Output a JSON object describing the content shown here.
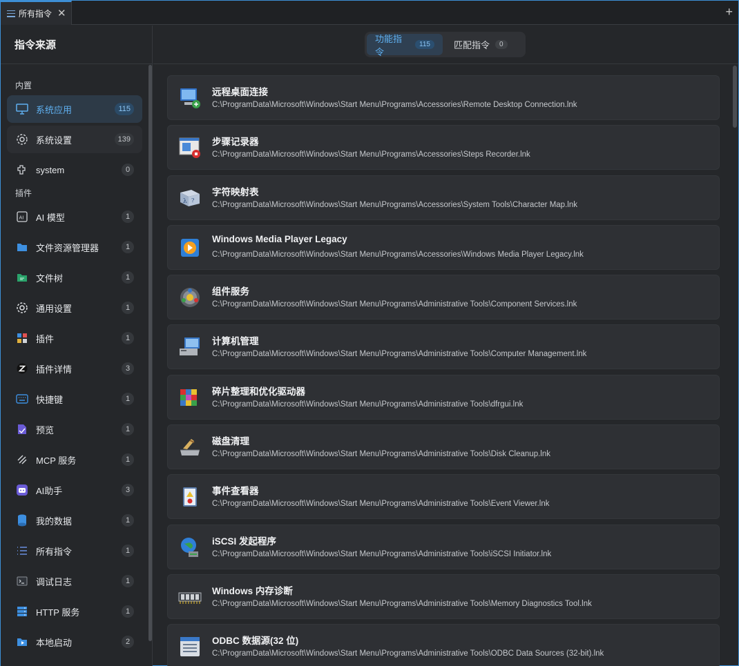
{
  "tab": {
    "title": "所有指令",
    "close_glyph": "✕",
    "add_glyph": "+"
  },
  "sidebar": {
    "title": "指令来源",
    "sections": {
      "builtin": "内置",
      "plugins": "插件"
    },
    "builtin_items": [
      {
        "label": "系统应用",
        "count": "115",
        "icon": "monitor-icon"
      },
      {
        "label": "系统设置",
        "count": "139",
        "icon": "gear-icon"
      },
      {
        "label": "system",
        "count": "0",
        "icon": "plugin-icon"
      }
    ],
    "plugin_items": [
      {
        "label": "AI 模型",
        "count": "1",
        "icon": "ai-model-icon"
      },
      {
        "label": "文件资源管理器",
        "count": "1",
        "icon": "folder-icon"
      },
      {
        "label": "文件树",
        "count": "1",
        "icon": "file-tree-icon"
      },
      {
        "label": "通用设置",
        "count": "1",
        "icon": "gear-icon"
      },
      {
        "label": "插件",
        "count": "1",
        "icon": "puzzle-icon"
      },
      {
        "label": "插件详情",
        "count": "3",
        "icon": "z-logo-icon"
      },
      {
        "label": "快捷键",
        "count": "1",
        "icon": "keyboard-icon"
      },
      {
        "label": "预览",
        "count": "1",
        "icon": "preview-icon"
      },
      {
        "label": "MCP 服务",
        "count": "1",
        "icon": "mcp-icon"
      },
      {
        "label": "AI助手",
        "count": "3",
        "icon": "robot-icon"
      },
      {
        "label": "我的数据",
        "count": "1",
        "icon": "database-icon"
      },
      {
        "label": "所有指令",
        "count": "1",
        "icon": "list-icon"
      },
      {
        "label": "调试日志",
        "count": "1",
        "icon": "terminal-icon"
      },
      {
        "label": "HTTP 服务",
        "count": "1",
        "icon": "server-icon"
      },
      {
        "label": "本地启动",
        "count": "2",
        "icon": "launch-folder-icon"
      }
    ]
  },
  "segments": {
    "functional": {
      "label": "功能指令",
      "count": "115"
    },
    "match": {
      "label": "匹配指令",
      "count": "0"
    }
  },
  "commands": [
    {
      "title": "远程桌面连接",
      "path": "C:\\ProgramData\\Microsoft\\Windows\\Start Menu\\Programs\\Accessories\\Remote Desktop Connection.lnk",
      "icon": "remote-desktop-icon"
    },
    {
      "title": "步骤记录器",
      "path": "C:\\ProgramData\\Microsoft\\Windows\\Start Menu\\Programs\\Accessories\\Steps Recorder.lnk",
      "icon": "steps-recorder-icon"
    },
    {
      "title": "字符映射表",
      "path": "C:\\ProgramData\\Microsoft\\Windows\\Start Menu\\Programs\\Accessories\\System Tools\\Character Map.lnk",
      "icon": "character-map-icon"
    },
    {
      "title": "Windows Media Player Legacy",
      "path": "C:\\ProgramData\\Microsoft\\Windows\\Start Menu\\Programs\\Accessories\\Windows Media Player Legacy.lnk",
      "icon": "media-player-icon"
    },
    {
      "title": "组件服务",
      "path": "C:\\ProgramData\\Microsoft\\Windows\\Start Menu\\Programs\\Administrative Tools\\Component Services.lnk",
      "icon": "component-services-icon"
    },
    {
      "title": "计算机管理",
      "path": "C:\\ProgramData\\Microsoft\\Windows\\Start Menu\\Programs\\Administrative Tools\\Computer Management.lnk",
      "icon": "computer-management-icon"
    },
    {
      "title": "碎片整理和优化驱动器",
      "path": "C:\\ProgramData\\Microsoft\\Windows\\Start Menu\\Programs\\Administrative Tools\\dfrgui.lnk",
      "icon": "defrag-icon"
    },
    {
      "title": "磁盘清理",
      "path": "C:\\ProgramData\\Microsoft\\Windows\\Start Menu\\Programs\\Administrative Tools\\Disk Cleanup.lnk",
      "icon": "disk-cleanup-icon"
    },
    {
      "title": "事件查看器",
      "path": "C:\\ProgramData\\Microsoft\\Windows\\Start Menu\\Programs\\Administrative Tools\\Event Viewer.lnk",
      "icon": "event-viewer-icon"
    },
    {
      "title": "iSCSI 发起程序",
      "path": "C:\\ProgramData\\Microsoft\\Windows\\Start Menu\\Programs\\Administrative Tools\\iSCSI Initiator.lnk",
      "icon": "iscsi-icon"
    },
    {
      "title": "Windows 内存诊断",
      "path": "C:\\ProgramData\\Microsoft\\Windows\\Start Menu\\Programs\\Administrative Tools\\Memory Diagnostics Tool.lnk",
      "icon": "memory-diagnostics-icon"
    },
    {
      "title": "ODBC 数据源(32 位)",
      "path": "C:\\ProgramData\\Microsoft\\Windows\\Start Menu\\Programs\\Administrative Tools\\ODBC Data Sources (32-bit).lnk",
      "icon": "odbc-icon"
    }
  ],
  "colors": {
    "accent": "#5fb0f0",
    "background": "#25272a",
    "card": "#2e3034"
  }
}
